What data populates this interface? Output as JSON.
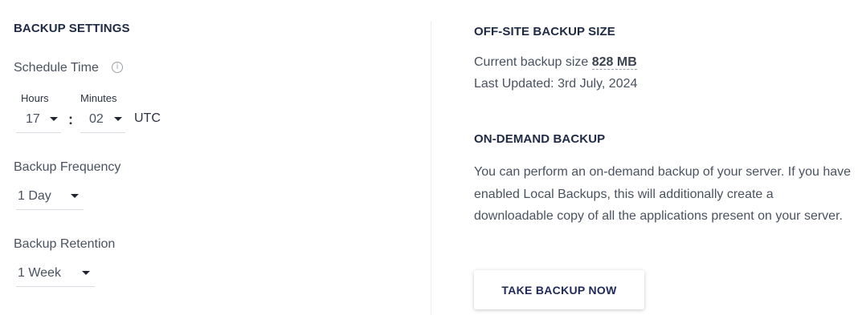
{
  "backup_settings": {
    "title": "BACKUP SETTINGS",
    "schedule_time": {
      "label": "Schedule Time",
      "info_icon": "info-icon",
      "hours_label": "Hours",
      "minutes_label": "Minutes",
      "hours_value": "17",
      "minutes_value": "02",
      "separator": ":",
      "timezone": "UTC"
    },
    "frequency": {
      "label": "Backup Frequency",
      "value": "1 Day"
    },
    "retention": {
      "label": "Backup Retention",
      "value": "1 Week"
    }
  },
  "offsite": {
    "title": "OFF-SITE BACKUP SIZE",
    "size_prefix": "Current backup size ",
    "size_value": "828 MB",
    "last_updated": "Last Updated: 3rd July, 2024"
  },
  "on_demand": {
    "title": "ON-DEMAND BACKUP",
    "description": "You can perform an on-demand backup of your server. If you have enabled Local Backups, this will additionally create a downloadable copy of all the applications present on your server.",
    "button_label": "TAKE BACKUP NOW"
  },
  "icons": {
    "dropdown": "caret-down-icon",
    "info": "info-icon"
  }
}
